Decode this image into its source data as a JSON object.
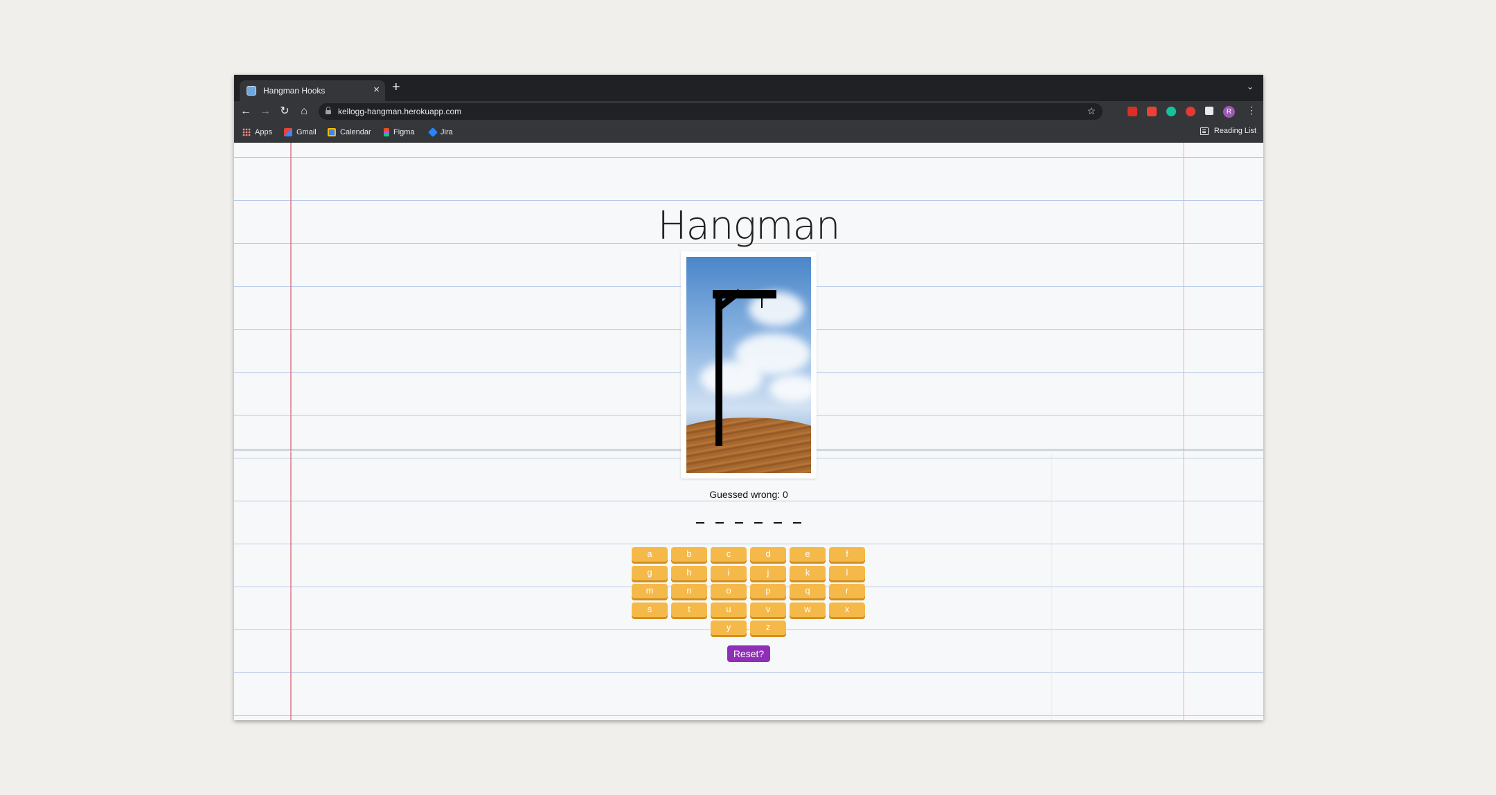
{
  "browser": {
    "tab_title": "Hangman Hooks",
    "url": "kellogg-hangman.herokuapp.com",
    "bookmarks": [
      {
        "label": "Apps",
        "icon": "apps-grid-icon"
      },
      {
        "label": "Gmail",
        "icon": "gmail-icon"
      },
      {
        "label": "Calendar",
        "icon": "calendar-icon"
      },
      {
        "label": "Figma",
        "icon": "figma-icon"
      },
      {
        "label": "Jira",
        "icon": "jira-icon"
      }
    ],
    "reading_list": "Reading List",
    "profile_initial": "R"
  },
  "game": {
    "title": "Hangman",
    "guessed_wrong_label": "Guessed wrong: 0",
    "word_length": 6,
    "letters": [
      "a",
      "b",
      "c",
      "d",
      "e",
      "f",
      "g",
      "h",
      "i",
      "j",
      "k",
      "l",
      "m",
      "n",
      "o",
      "p",
      "q",
      "r",
      "s",
      "t",
      "u",
      "v",
      "w",
      "x",
      "y",
      "z"
    ],
    "reset_label": "Reset?"
  },
  "colors": {
    "key": "#f5b94a",
    "reset": "#8e2fb6"
  }
}
